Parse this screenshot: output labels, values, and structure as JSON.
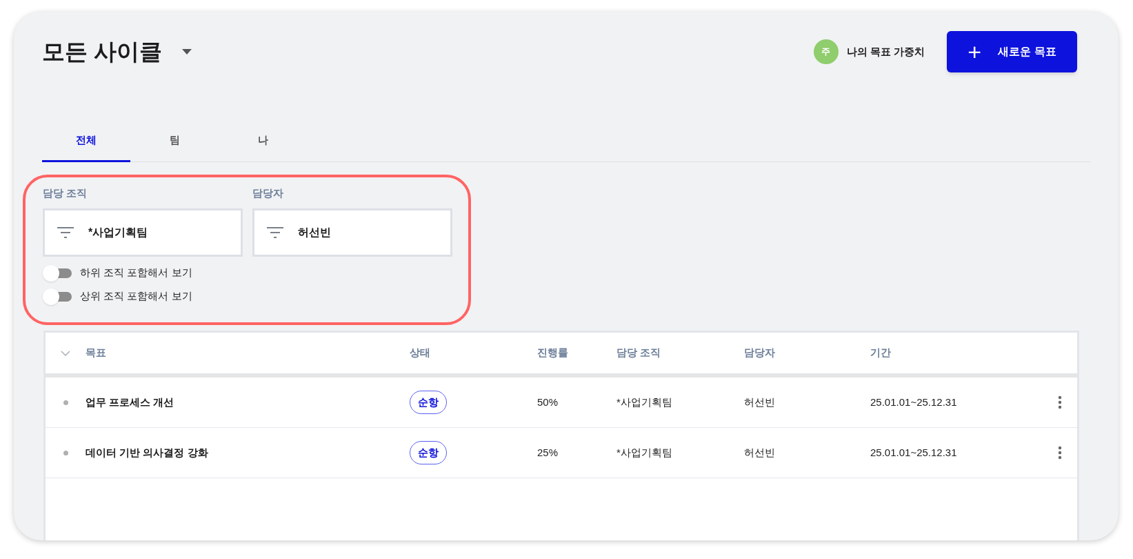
{
  "header": {
    "title": "모든 사이클",
    "weight": {
      "avatar": "주",
      "label": "나의 목표 가중치"
    },
    "new_button": {
      "icon": "+",
      "label": "새로운 목표"
    }
  },
  "tabs": [
    {
      "label": "전체",
      "selected": true
    },
    {
      "label": "팀",
      "selected": false
    },
    {
      "label": "나",
      "selected": false
    }
  ],
  "filters": [
    {
      "label": "담당 조직",
      "value": "*사업기획팀"
    },
    {
      "label": "담당자",
      "value": "허선빈"
    }
  ],
  "toggles": [
    {
      "label": "하위 조직 포함해서 보기",
      "on": false
    },
    {
      "label": "상위 조직 포함해서 보기",
      "on": false
    }
  ],
  "table": {
    "columns": [
      "목표",
      "상태",
      "진행률",
      "담당 조직",
      "담당자",
      "기간"
    ],
    "rows": [
      {
        "goal": "업무 프로세스 개선",
        "status": "순항",
        "progress": "50%",
        "org": "*사업기획팀",
        "owner": "허선빈",
        "period": "25.01.01~25.12.31"
      },
      {
        "goal": "데이터 기반 의사결정 강화",
        "status": "순항",
        "progress": "25%",
        "org": "*사업기획팀",
        "owner": "허선빈",
        "period": "25.01.01~25.12.31"
      }
    ]
  }
}
